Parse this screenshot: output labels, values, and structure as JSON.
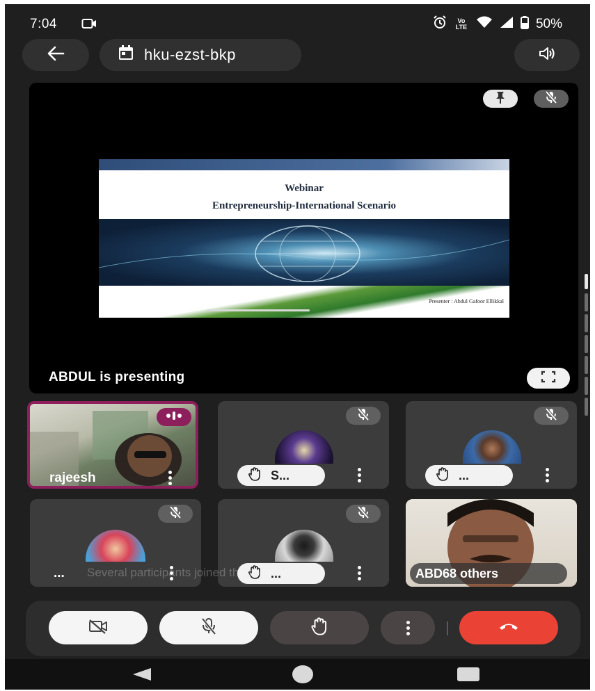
{
  "status_bar": {
    "time": "7:04",
    "lte_label": "Vo LTE",
    "battery": "50%"
  },
  "top_bar": {
    "meeting_code": "hku-ezst-bkp"
  },
  "presentation": {
    "slide_title": "Webinar",
    "slide_subtitle": "Entrepreneurship-International Scenario",
    "slide_presenter": "Presenter : Abdul Gafoor Ellikkal",
    "presenting_label": "ABDUL is presenting"
  },
  "tiles": [
    {
      "name": "rajeesh"
    },
    {
      "name": "S..."
    },
    {
      "name": "..."
    },
    {
      "name": "..."
    },
    {
      "name": "..."
    },
    {
      "name": "ABD",
      "others": "68 others"
    }
  ],
  "toast": "Several participants joined the meeting",
  "colors": {
    "background": "#1f1f1f",
    "surface": "#3c3c3c",
    "active_speaker": "#8c1f5c",
    "end_call": "#ea4335",
    "hand_raise_button": "#4a4444"
  },
  "icons": {
    "back": "arrow-left-icon",
    "calendar": "calendar-icon",
    "speaker": "volume-icon",
    "pin": "pin-icon",
    "mic_off": "mic-off-icon",
    "fullscreen": "fullscreen-icon",
    "camera_off": "camera-off-icon",
    "hand": "raise-hand-icon",
    "more": "more-vert-icon",
    "end_call": "end-call-icon"
  }
}
